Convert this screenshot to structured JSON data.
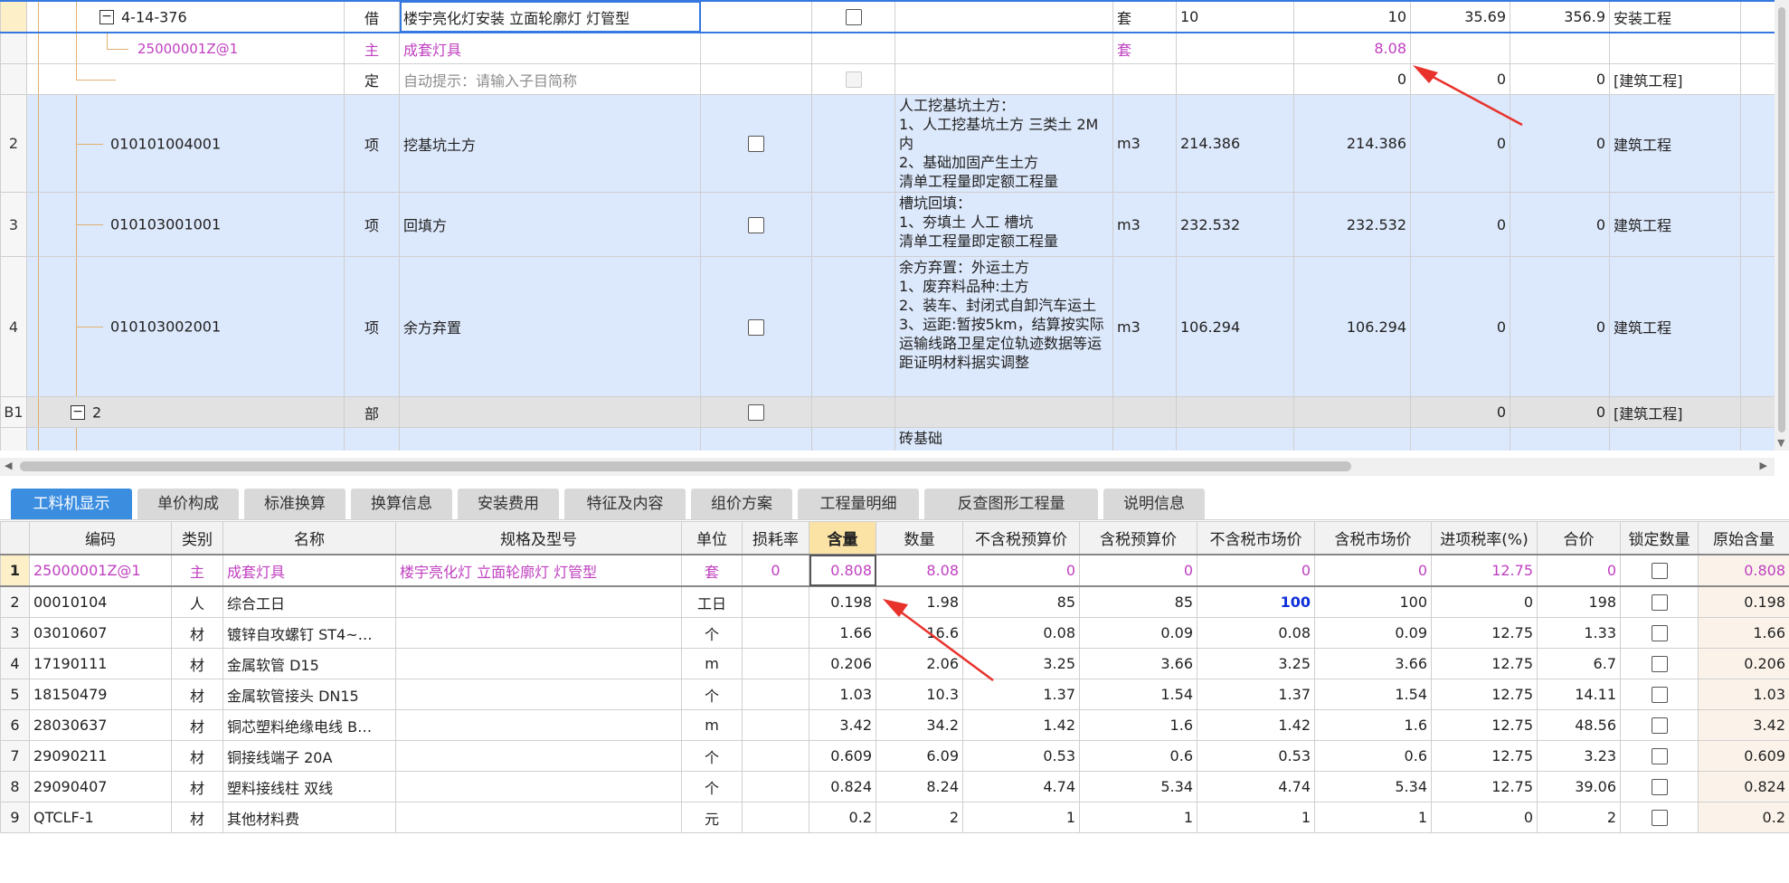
{
  "top": {
    "rows": [
      {
        "num": "",
        "code": "4-14-376",
        "type": "借",
        "name": "楼宇亮化灯安装 立面轮廓灯 灯管型",
        "spec": "",
        "unit": "套",
        "expr": "10",
        "qty": "10",
        "price": "35.69",
        "total": "356.9",
        "major": "安装工程"
      },
      {
        "num": "",
        "code": "25000001Z@1",
        "type": "主",
        "name": "成套灯具",
        "spec": "",
        "unit": "套",
        "expr": "",
        "qty": "8.08",
        "price": "",
        "total": "",
        "major": ""
      },
      {
        "num": "",
        "code": "",
        "type": "定",
        "name": "自动提示：请输入子目简称",
        "spec": "",
        "unit": "",
        "expr": "",
        "qty": "0",
        "price": "0",
        "total": "0",
        "major": "[建筑工程]"
      },
      {
        "num": "2",
        "code": "010101004001",
        "type": "项",
        "name": "挖基坑土方",
        "spec": "人工挖基坑土方：\n1、人工挖基坑土方 三类土 2M内\n2、基础加固产生土方\n清单工程量即定额工程量",
        "unit": "m3",
        "expr": "214.386",
        "qty": "214.386",
        "price": "0",
        "total": "0",
        "major": "建筑工程"
      },
      {
        "num": "3",
        "code": "010103001001",
        "type": "项",
        "name": "回填方",
        "spec": "槽坑回填：\n1、夯填土 人工 槽坑\n清单工程量即定额工程量",
        "unit": "m3",
        "expr": "232.532",
        "qty": "232.532",
        "price": "0",
        "total": "0",
        "major": "建筑工程"
      },
      {
        "num": "4",
        "code": "010103002001",
        "type": "项",
        "name": "余方弃置",
        "spec": "余方弃置：外运土方\n1、废弃料品种:土方\n2、装车、封闭式自卸汽车运土\n3、运距:暂按5km，结算按实际运输线路卫星定位轨迹数据等运距证明材料据实调整",
        "unit": "m3",
        "expr": "106.294",
        "qty": "106.294",
        "price": "0",
        "total": "0",
        "major": "建筑工程"
      },
      {
        "num": "B1",
        "code": "2",
        "type": "部",
        "name": "",
        "spec": "",
        "unit": "",
        "expr": "",
        "qty": "",
        "price": "0",
        "total": "0",
        "major": "[建筑工程]"
      },
      {
        "num": "",
        "code": "",
        "type": "",
        "name": "",
        "spec": "砖基础",
        "unit": "",
        "expr": "",
        "qty": "",
        "price": "",
        "total": "",
        "major": ""
      }
    ]
  },
  "tabs": [
    "工料机显示",
    "单价构成",
    "标准换算",
    "换算信息",
    "安装费用",
    "特征及内容",
    "组价方案",
    "工程量明细",
    "反查图形工程量",
    "说明信息"
  ],
  "bottom": {
    "headers": [
      "编码",
      "类别",
      "名称",
      "规格及型号",
      "单位",
      "损耗率",
      "含量",
      "数量",
      "不含税预算价",
      "含税预算价",
      "不含税市场价",
      "含税市场价",
      "进项税率(%)",
      "合价",
      "锁定数量",
      "原始含量"
    ],
    "rows": [
      {
        "num": "1",
        "code": "25000001Z@1",
        "cat": "主",
        "name": "成套灯具",
        "spec": "楼宇亮化灯 立面轮廓灯 灯管型",
        "unit": "套",
        "loss": "0",
        "content": "0.808",
        "qty": "8.08",
        "pre_notax": "0",
        "pre_tax": "0",
        "mkt_notax": "0",
        "mkt_tax": "0",
        "rate": "12.75",
        "total": "0",
        "orig": "0.808"
      },
      {
        "num": "2",
        "code": "00010104",
        "cat": "人",
        "name": "综合工日",
        "spec": "",
        "unit": "工日",
        "loss": "",
        "content": "0.198",
        "qty": "1.98",
        "pre_notax": "85",
        "pre_tax": "85",
        "mkt_notax": "100",
        "mkt_tax": "100",
        "rate": "0",
        "total": "198",
        "orig": "0.198"
      },
      {
        "num": "3",
        "code": "03010607",
        "cat": "材",
        "name": "镀锌自攻螺钉 ST4~…",
        "spec": "",
        "unit": "个",
        "loss": "",
        "content": "1.66",
        "qty": "16.6",
        "pre_notax": "0.08",
        "pre_tax": "0.09",
        "mkt_notax": "0.08",
        "mkt_tax": "0.09",
        "rate": "12.75",
        "total": "1.33",
        "orig": "1.66"
      },
      {
        "num": "4",
        "code": "17190111",
        "cat": "材",
        "name": "金属软管 D15",
        "spec": "",
        "unit": "m",
        "loss": "",
        "content": "0.206",
        "qty": "2.06",
        "pre_notax": "3.25",
        "pre_tax": "3.66",
        "mkt_notax": "3.25",
        "mkt_tax": "3.66",
        "rate": "12.75",
        "total": "6.7",
        "orig": "0.206"
      },
      {
        "num": "5",
        "code": "18150479",
        "cat": "材",
        "name": "金属软管接头 DN15",
        "spec": "",
        "unit": "个",
        "loss": "",
        "content": "1.03",
        "qty": "10.3",
        "pre_notax": "1.37",
        "pre_tax": "1.54",
        "mkt_notax": "1.37",
        "mkt_tax": "1.54",
        "rate": "12.75",
        "total": "14.11",
        "orig": "1.03"
      },
      {
        "num": "6",
        "code": "28030637",
        "cat": "材",
        "name": "铜芯塑料绝缘电线 B…",
        "spec": "",
        "unit": "m",
        "loss": "",
        "content": "3.42",
        "qty": "34.2",
        "pre_notax": "1.42",
        "pre_tax": "1.6",
        "mkt_notax": "1.42",
        "mkt_tax": "1.6",
        "rate": "12.75",
        "total": "48.56",
        "orig": "3.42"
      },
      {
        "num": "7",
        "code": "29090211",
        "cat": "材",
        "name": "铜接线端子 20A",
        "spec": "",
        "unit": "个",
        "loss": "",
        "content": "0.609",
        "qty": "6.09",
        "pre_notax": "0.53",
        "pre_tax": "0.6",
        "mkt_notax": "0.53",
        "mkt_tax": "0.6",
        "rate": "12.75",
        "total": "3.23",
        "orig": "0.609"
      },
      {
        "num": "8",
        "code": "29090407",
        "cat": "材",
        "name": "塑料接线柱 双线",
        "spec": "",
        "unit": "个",
        "loss": "",
        "content": "0.824",
        "qty": "8.24",
        "pre_notax": "4.74",
        "pre_tax": "5.34",
        "mkt_notax": "4.74",
        "mkt_tax": "5.34",
        "rate": "12.75",
        "total": "39.06",
        "orig": "0.824"
      },
      {
        "num": "9",
        "code": "QTCLF-1",
        "cat": "材",
        "name": "其他材料费",
        "spec": "",
        "unit": "元",
        "loss": "",
        "content": "0.2",
        "qty": "2",
        "pre_notax": "1",
        "pre_tax": "1",
        "mkt_notax": "1",
        "mkt_tax": "1",
        "rate": "0",
        "total": "2",
        "orig": "0.2"
      }
    ]
  },
  "colors": {
    "accent": "#3b8de0",
    "pink": "#c040c0",
    "arrow": "#e8322c",
    "row_blue": "#dce8fb"
  }
}
